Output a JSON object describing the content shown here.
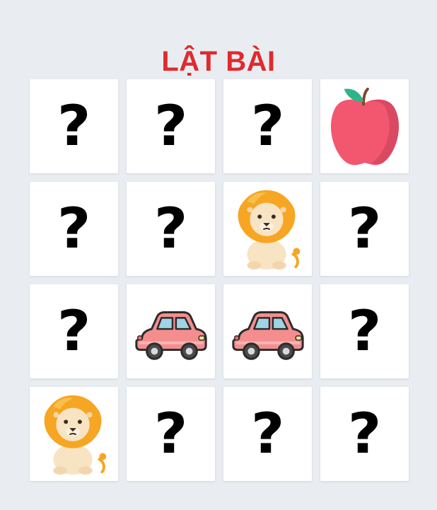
{
  "title": "LẬT BÀI",
  "hidden_symbol": "?",
  "cards": [
    {
      "state": "hidden",
      "face": null
    },
    {
      "state": "hidden",
      "face": null
    },
    {
      "state": "hidden",
      "face": null
    },
    {
      "state": "revealed",
      "face": "apple"
    },
    {
      "state": "hidden",
      "face": null
    },
    {
      "state": "hidden",
      "face": null
    },
    {
      "state": "revealed",
      "face": "lion"
    },
    {
      "state": "hidden",
      "face": null
    },
    {
      "state": "hidden",
      "face": null
    },
    {
      "state": "revealed",
      "face": "car"
    },
    {
      "state": "revealed",
      "face": "car"
    },
    {
      "state": "hidden",
      "face": null
    },
    {
      "state": "revealed",
      "face": "lion"
    },
    {
      "state": "hidden",
      "face": null
    },
    {
      "state": "hidden",
      "face": null
    },
    {
      "state": "hidden",
      "face": null
    }
  ],
  "icons": {
    "hidden": "question-mark-icon",
    "apple": "apple-icon",
    "lion": "lion-icon",
    "car": "car-icon"
  },
  "colors": {
    "title": "#e02a2d",
    "background": "#e9edf1",
    "card": "#ffffff",
    "apple": "#f2576f",
    "car": "#f48e8e",
    "lion_mane": "#f6a622"
  }
}
